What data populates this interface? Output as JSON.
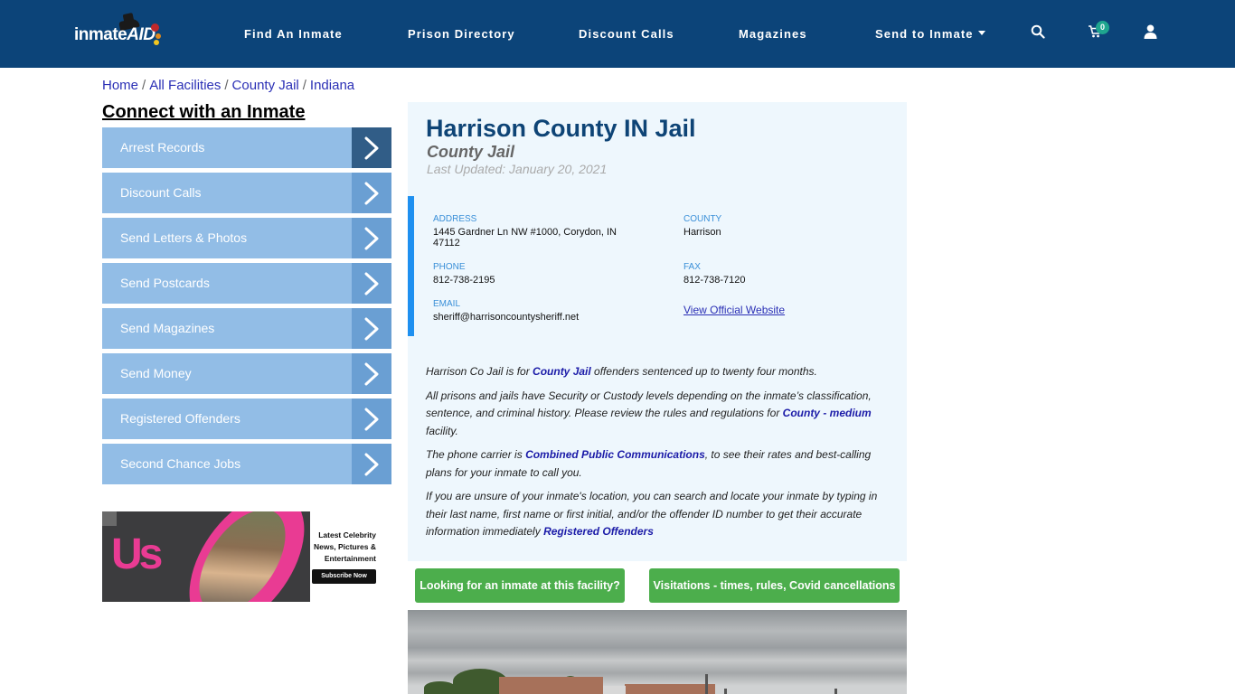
{
  "brand": {
    "logo_text_main": "inmate",
    "logo_text_accent": "AID"
  },
  "nav": {
    "items": [
      {
        "label": "Find An Inmate"
      },
      {
        "label": "Prison Directory"
      },
      {
        "label": "Discount Calls"
      },
      {
        "label": "Magazines"
      },
      {
        "label": "Send to Inmate",
        "has_dropdown": true
      }
    ],
    "icons": [
      "search-icon",
      "cart-icon",
      "user-icon"
    ],
    "cart_count": "0"
  },
  "breadcrumb": [
    {
      "label": "Home"
    },
    {
      "label": "All Facilities"
    },
    {
      "label": "County Jail"
    },
    {
      "label": "Indiana"
    }
  ],
  "sidebar": {
    "title": "Connect with an Inmate",
    "items": [
      {
        "label": "Arrest Records",
        "active": true
      },
      {
        "label": "Discount Calls"
      },
      {
        "label": "Send Letters & Photos"
      },
      {
        "label": "Send Postcards"
      },
      {
        "label": "Send Magazines"
      },
      {
        "label": "Send Money"
      },
      {
        "label": "Registered Offenders"
      },
      {
        "label": "Second Chance Jobs"
      }
    ],
    "ad": {
      "brand": "Us",
      "tagline_1": "Latest Celebrity",
      "tagline_2": "News, Pictures &",
      "tagline_3": "Entertainment",
      "button": "Subscribe Now"
    }
  },
  "facility": {
    "title": "Harrison County IN Jail",
    "type": "County Jail",
    "last_updated": "Last Updated: January 20, 2021",
    "address_label": "ADDRESS",
    "address": "1445 Gardner Ln NW #1000, Corydon, IN 47112",
    "county_label": "COUNTY",
    "county": "Harrison",
    "phone_label": "PHONE",
    "phone": "812-738-2195",
    "fax_label": "FAX",
    "fax": "812-738-7120",
    "email_label": "EMAIL",
    "email": "sheriff@harrisoncountysheriff.net",
    "website_link": "View Official Website"
  },
  "description": {
    "p1_a": "Harrison Co Jail is for ",
    "p1_link": "County Jail",
    "p1_b": " offenders sentenced up to twenty four months.",
    "p2_a": "All prisons and jails have Security or Custody levels depending on the inmate’s classification, sentence, and criminal history. Please review the rules and regulations for ",
    "p2_link": "County - medium",
    "p2_b": " facility.",
    "p3_a": "The phone carrier is ",
    "p3_link": "Combined Public Communications",
    "p3_b": ", to see their rates and best-calling plans for your inmate to call you.",
    "p4_a": "If you are unsure of your inmate's location, you can search and locate your inmate by typing in their last name, first name or first initial, and/or the offender ID number to get their accurate information immediately ",
    "p4_link": "Registered Offenders"
  },
  "actions": {
    "find_inmate": "Looking for an inmate at this facility?",
    "visitations": "Visitations - times, rules, Covid cancellations"
  },
  "colors": {
    "navbar": "#0c4479",
    "sidebar_item": "#92bde6",
    "sidebar_arrow": "#6a9fd3",
    "sidebar_arrow_active": "#315d87",
    "panel_bg": "#eef7fd",
    "accent_border": "#1e90f0",
    "button_green": "#4cae4c"
  }
}
